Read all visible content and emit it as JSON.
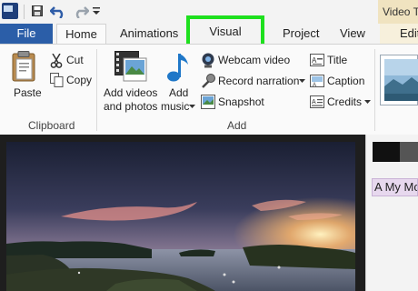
{
  "window": {
    "context_tab": "Video To",
    "context_subtab": "Edit"
  },
  "tabs": {
    "file": "File",
    "home": "Home",
    "animations": "Animations",
    "visual_effects": "Visual Effects",
    "project": "Project",
    "view": "View"
  },
  "clipboard": {
    "paste": "Paste",
    "cut": "Cut",
    "copy": "Copy",
    "group": "Clipboard"
  },
  "add": {
    "add_videos_line1": "Add videos",
    "add_videos_line2": "and photos",
    "add_music_line1": "Add",
    "add_music_line2": "music",
    "webcam": "Webcam video",
    "record": "Record narration",
    "snapshot": "Snapshot",
    "title": "Title",
    "caption": "Caption",
    "credits": "Credits",
    "group": "Add"
  },
  "storyboard": {
    "caption_chip": "A My Mo"
  },
  "icons": [
    "app-icon",
    "save-icon",
    "undo-icon",
    "redo-icon",
    "qat-more-icon",
    "paste-icon",
    "cut-icon",
    "copy-icon",
    "film-photo-icon",
    "music-note-icon",
    "webcam-icon",
    "microphone-icon",
    "snapshot-icon",
    "title-icon",
    "caption-icon",
    "credits-icon",
    "dropdown-arrow-icon"
  ],
  "colors": {
    "file_tab": "#2b5ea8",
    "highlight": "#1ee01e",
    "context_tab": "#f0e3c0",
    "caption_chip": "#e7d8ee"
  }
}
